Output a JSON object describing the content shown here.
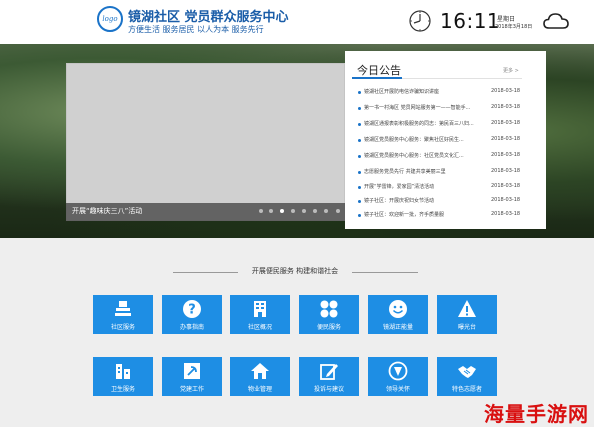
{
  "header": {
    "logo_text": "logo",
    "title": "镜湖社区 党员群众服务中心",
    "slogan": "方便生活 服务居民 以人为本 服务先行",
    "time": "16:11",
    "weekday": "星期日",
    "date": "2018年3月18日"
  },
  "slider": {
    "caption": "开展“趣味庆三八”活动",
    "dots": 8,
    "active_dot": 3
  },
  "notice": {
    "title": "今日公告",
    "more": "更多 >",
    "items": [
      {
        "title": "镜湖社区开展防电信诈骗知识讲座",
        "date": "2018-03-18"
      },
      {
        "title": "第一书一村海区 党员网站服务第一——智能手...",
        "date": "2018-03-18"
      },
      {
        "title": "镜湖区通报表彰积极服务的同志：第民百三八妇...",
        "date": "2018-03-18"
      },
      {
        "title": "镜湖区党员服务中心服务：聚焦社区好民生...",
        "date": "2018-03-18"
      },
      {
        "title": "镜湖区党员服务中心服务：社区党员文化汇...",
        "date": "2018-03-18"
      },
      {
        "title": "志愿服务党员先行 共建共享美丽三里",
        "date": "2018-03-18"
      },
      {
        "title": "开展“学雷锋，爱家园”清洁活动",
        "date": "2018-03-18"
      },
      {
        "title": "镜子社区：开展庆祝妇女节活动",
        "date": "2018-03-18"
      },
      {
        "title": "镜子社区：欢迎新一批，齐手质量服",
        "date": "2018-03-18"
      }
    ]
  },
  "services": {
    "title": "开展便民服务 构建和谐社会",
    "tiles": [
      {
        "label": "社区服务",
        "icon": "community-icon"
      },
      {
        "label": "办事指南",
        "icon": "question-icon"
      },
      {
        "label": "社区概况",
        "icon": "building-icon"
      },
      {
        "label": "便民服务",
        "icon": "grid-icon"
      },
      {
        "label": "镜湖正能量",
        "icon": "smile-icon"
      },
      {
        "label": "曝光台",
        "icon": "warning-icon"
      },
      {
        "label": "卫生服务",
        "icon": "health-icon"
      },
      {
        "label": "党建工作",
        "icon": "party-icon"
      },
      {
        "label": "物业管理",
        "icon": "home-icon"
      },
      {
        "label": "投诉与建议",
        "icon": "edit-icon"
      },
      {
        "label": "领导关怀",
        "icon": "leader-icon"
      },
      {
        "label": "特色志愿者",
        "icon": "handshake-icon"
      }
    ]
  },
  "watermark": "海量手游网",
  "colors": {
    "brand_blue": "#1a5da8",
    "tile_blue": "#1e8ee4",
    "accent_blue": "#1a73c8",
    "watermark_red": "#d91010"
  }
}
